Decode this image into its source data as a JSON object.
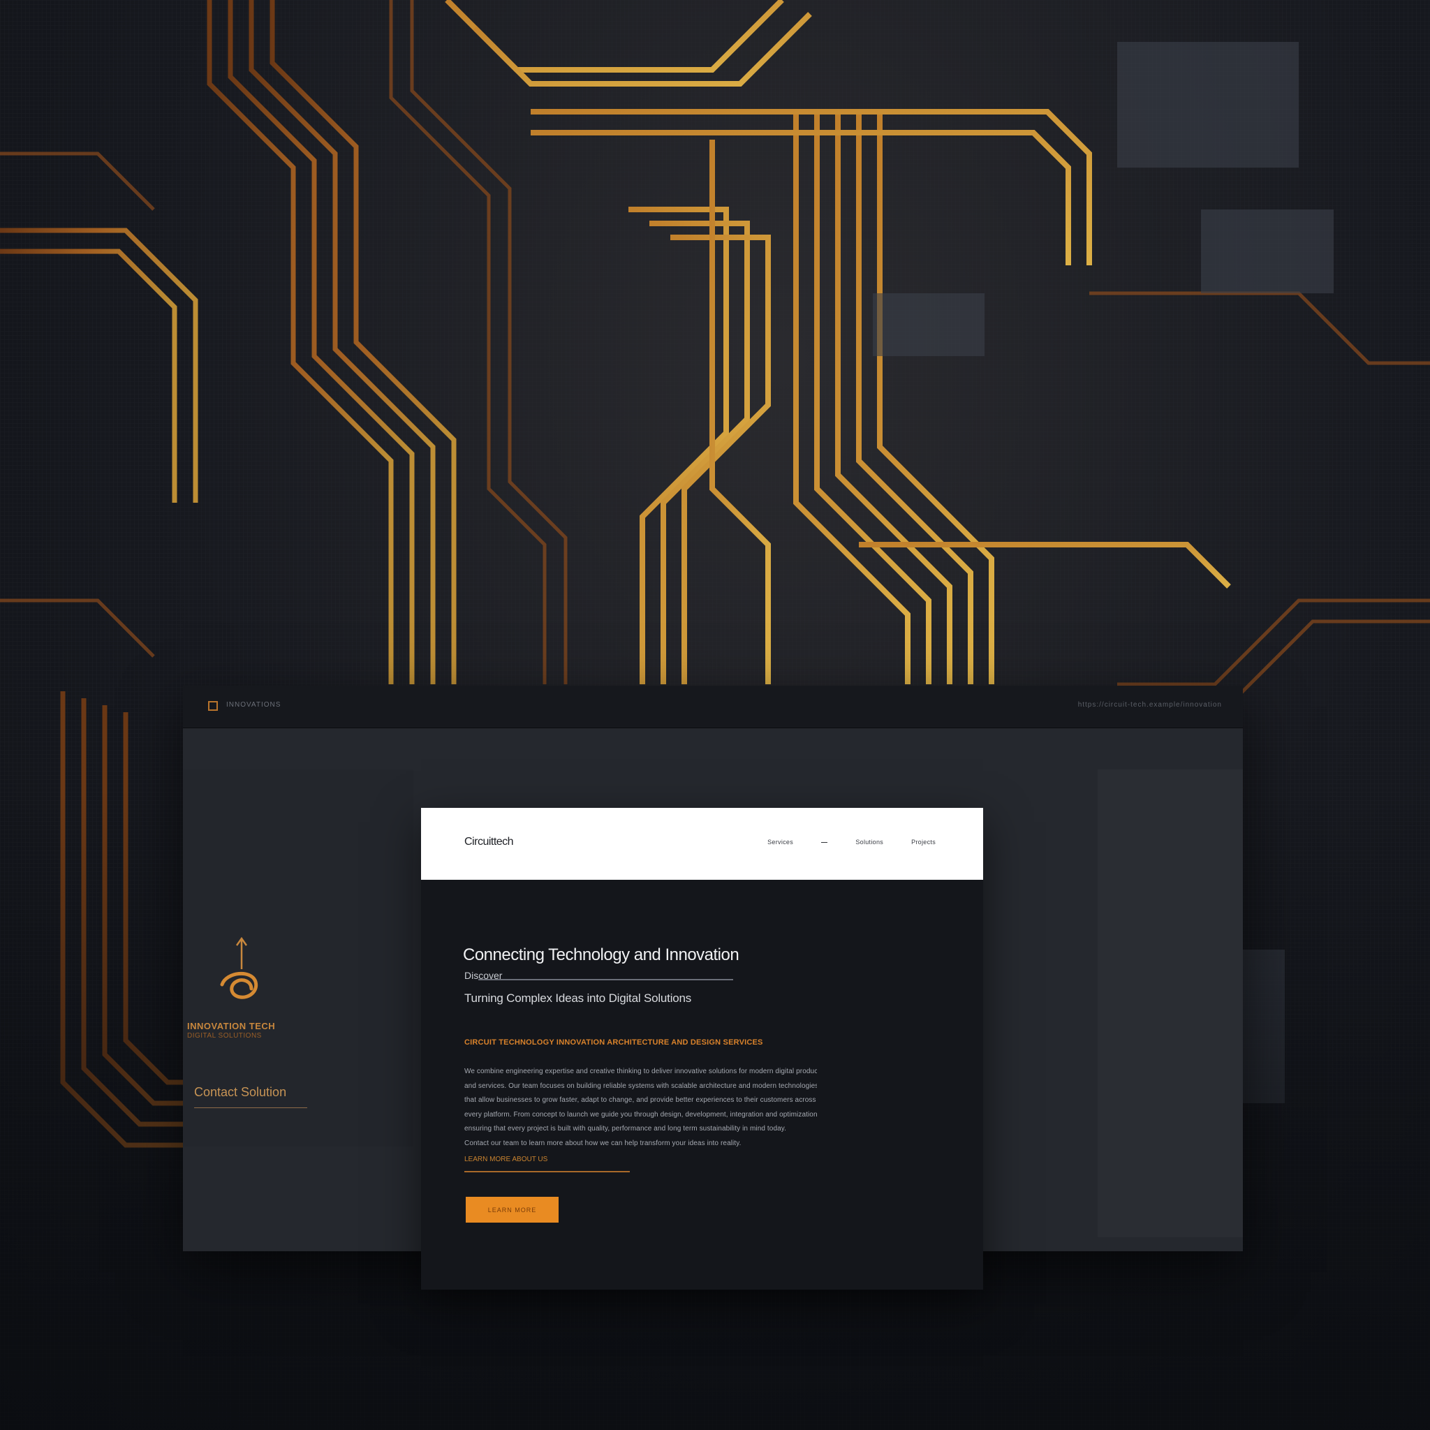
{
  "window": {
    "title": "INNOVATIONS",
    "url": "https://circuit-tech.example/innovation"
  },
  "brand": {
    "name": "INNOVATION TECH",
    "sub": "DIGITAL SOLUTIONS",
    "link": "Contact Solution",
    "accent": "#c8873d"
  },
  "page": {
    "nav": {
      "logo": "Circuittech",
      "links": [
        "Services",
        "—",
        "Solutions",
        "Projects"
      ]
    },
    "hero": {
      "title": "Connecting Technology and Innovation",
      "line1": "Discover",
      "subtitle": "Turning Complex Ideas into Digital Solutions"
    },
    "kicker": "CIRCUIT TECHNOLOGY INNOVATION ARCHITECTURE AND DESIGN SERVICES",
    "body": [
      "We combine engineering expertise and creative thinking to deliver innovative solutions for modern digital products",
      "and services. Our team focuses on building reliable systems with scalable architecture and modern technologies",
      "that allow businesses to grow faster, adapt to change, and provide better experiences to their customers across",
      "every platform. From concept to launch we guide you through design, development, integration and optimization",
      "ensuring that every project is built with quality, performance and long term sustainability in mind today.",
      "Contact our team to learn more about how we can help transform your ideas into reality."
    ],
    "small_link": "LEARN MORE ABOUT US",
    "cta": "LEARN MORE",
    "accent": "#e98b22"
  }
}
